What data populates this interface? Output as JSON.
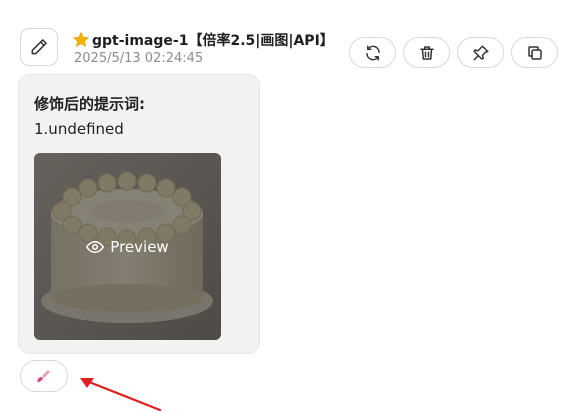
{
  "message": {
    "model_name": "gpt-image-1【倍率2.5|画图|API】",
    "timestamp": "2025/5/13 02:24:45",
    "avatar_icon": "pencil-icon",
    "model_icon": "star-icon"
  },
  "actions": [
    {
      "name": "regenerate",
      "icon": "refresh-icon"
    },
    {
      "name": "delete",
      "icon": "trash-icon"
    },
    {
      "name": "pin",
      "icon": "pin-icon"
    },
    {
      "name": "copy",
      "icon": "copy-icon"
    }
  ],
  "bubble": {
    "heading": "修饰后的提示词:",
    "text": "1.undefined",
    "image_alt_icon": "cake-image",
    "preview_label": "Preview",
    "preview_icon": "eye-icon"
  },
  "footer": {
    "brush_icon": "brush-icon"
  },
  "annotation": {
    "arrow_color": "#e02020"
  }
}
